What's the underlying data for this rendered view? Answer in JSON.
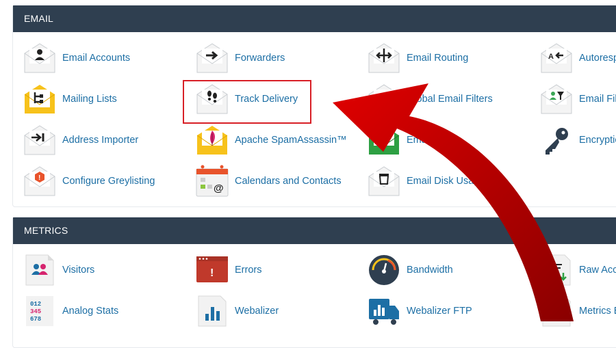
{
  "email": {
    "header": "EMAIL",
    "items": [
      {
        "label": "Email Accounts",
        "icon": "email-accounts-icon"
      },
      {
        "label": "Forwarders",
        "icon": "forwarders-icon"
      },
      {
        "label": "Email Routing",
        "icon": "email-routing-icon"
      },
      {
        "label": "Autoresp",
        "icon": "autoresponders-icon"
      },
      {
        "label": "Mailing Lists",
        "icon": "mailing-lists-icon"
      },
      {
        "label": "Track Delivery",
        "icon": "track-delivery-icon"
      },
      {
        "label": "Global Email Filters",
        "icon": "global-email-filters-icon"
      },
      {
        "label": "Email Fil",
        "icon": "email-filters-icon"
      },
      {
        "label": "Address Importer",
        "icon": "address-importer-icon"
      },
      {
        "label": "Apache SpamAssassin™",
        "icon": "spamassassin-icon"
      },
      {
        "label": "Email Marke",
        "icon": "email-marketing-icon"
      },
      {
        "label": "Encryptio",
        "icon": "encryption-key-icon"
      },
      {
        "label": "Configure Greylisting",
        "icon": "greylisting-icon"
      },
      {
        "label": "Calendars and Contacts",
        "icon": "calendars-contacts-icon"
      },
      {
        "label": "Email Disk Usage",
        "icon": "email-disk-usage-icon"
      }
    ]
  },
  "metrics": {
    "header": "METRICS",
    "items": [
      {
        "label": "Visitors",
        "icon": "visitors-icon"
      },
      {
        "label": "Errors",
        "icon": "errors-icon"
      },
      {
        "label": "Bandwidth",
        "icon": "bandwidth-icon"
      },
      {
        "label": "Raw Acce",
        "icon": "raw-access-icon"
      },
      {
        "label": "Analog Stats",
        "icon": "analog-stats-icon"
      },
      {
        "label": "Webalizer",
        "icon": "webalizer-icon"
      },
      {
        "label": "Webalizer FTP",
        "icon": "webalizer-ftp-icon"
      },
      {
        "label": "Metrics E",
        "icon": "metrics-editor-icon"
      }
    ]
  },
  "colors": {
    "header_bg": "#2f3f50",
    "link": "#1d6fa5",
    "highlight": "#d81f26",
    "annotation_arrow": "#b80000"
  }
}
